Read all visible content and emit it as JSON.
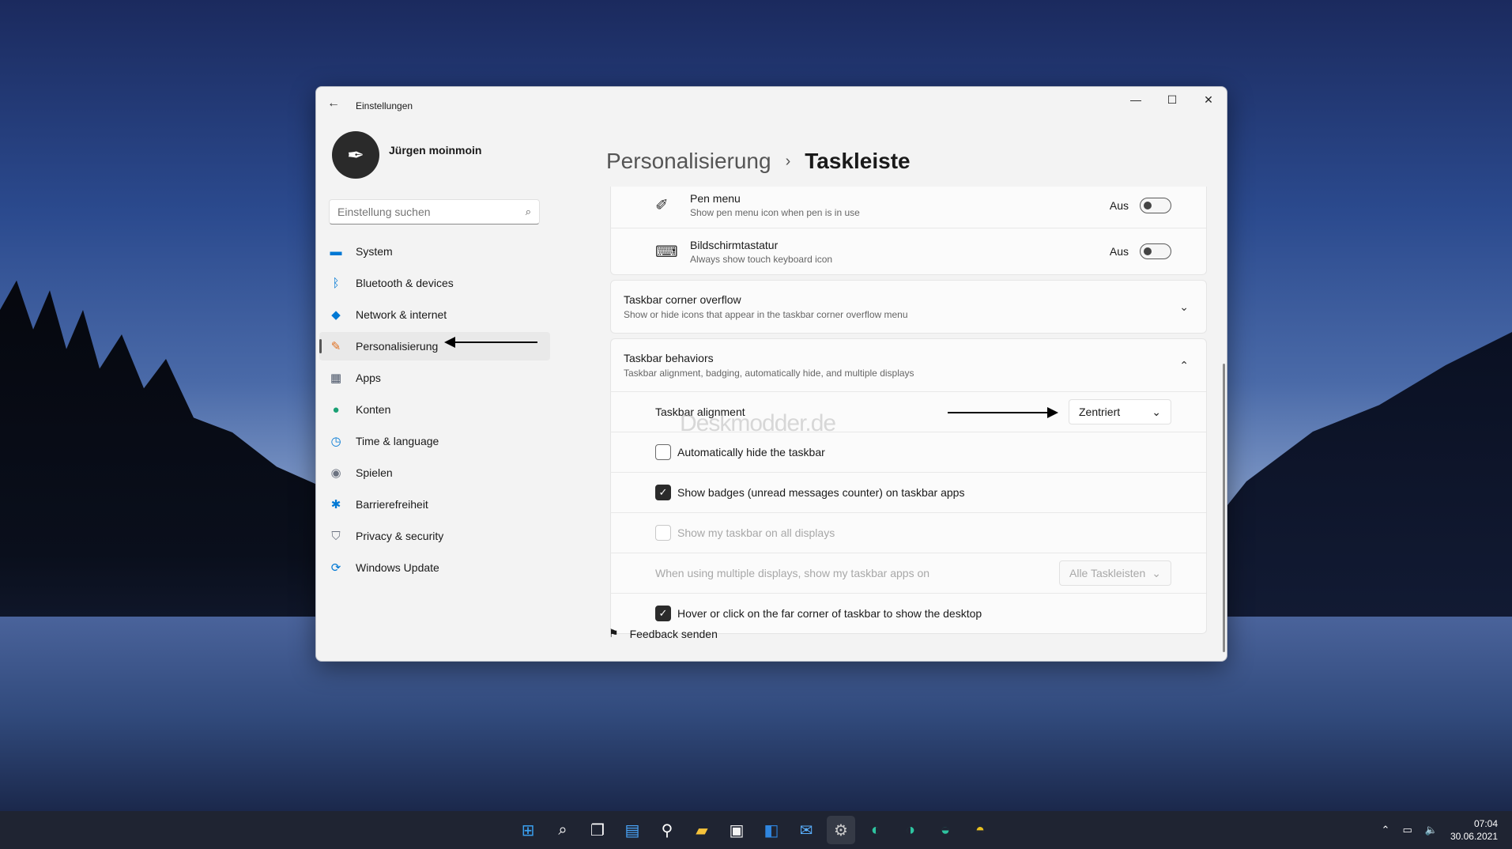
{
  "desktop": {
    "watermark": "Deskmodder.de"
  },
  "window": {
    "app_title": "Einstellungen",
    "minimize": "—",
    "maximize": "☐",
    "close": "✕"
  },
  "profile": {
    "name": "Jürgen moinmoin"
  },
  "search": {
    "placeholder": "Einstellung suchen"
  },
  "sidebar": {
    "items": [
      {
        "label": "System",
        "icon": "monitor-icon",
        "color": "#0078d4"
      },
      {
        "label": "Bluetooth & devices",
        "icon": "bluetooth-icon",
        "color": "#0078d4"
      },
      {
        "label": "Network & internet",
        "icon": "wifi-icon",
        "color": "#0078d4"
      },
      {
        "label": "Personalisierung",
        "icon": "brush-icon",
        "color": "#e07020"
      },
      {
        "label": "Apps",
        "icon": "apps-icon",
        "color": "#4a5568"
      },
      {
        "label": "Konten",
        "icon": "person-icon",
        "color": "#1aa074"
      },
      {
        "label": "Time & language",
        "icon": "globe-clock-icon",
        "color": "#0078d4"
      },
      {
        "label": "Spielen",
        "icon": "gamepad-icon",
        "color": "#6b7280"
      },
      {
        "label": "Barrierefreiheit",
        "icon": "accessibility-icon",
        "color": "#0078d4"
      },
      {
        "label": "Privacy & security",
        "icon": "shield-icon",
        "color": "#6b7280"
      },
      {
        "label": "Windows Update",
        "icon": "update-icon",
        "color": "#0078d4"
      }
    ],
    "selected": "Personalisierung"
  },
  "breadcrumb": {
    "parent": "Personalisierung",
    "separator": "›",
    "current": "Taskleiste"
  },
  "pen_menu": {
    "title": "Pen menu",
    "subtitle": "Show pen menu icon when pen is in use",
    "state": "Aus"
  },
  "touch_keyboard": {
    "title": "Bildschirmtastatur",
    "subtitle": "Always show touch keyboard icon",
    "state": "Aus"
  },
  "corner_overflow": {
    "title": "Taskbar corner overflow",
    "subtitle": "Show or hide icons that appear in the taskbar corner overflow menu"
  },
  "behaviors": {
    "title": "Taskbar behaviors",
    "subtitle": "Taskbar alignment, badging, automatically hide, and multiple displays",
    "alignment_label": "Taskbar alignment",
    "alignment_value": "Zentriert",
    "auto_hide": "Automatically hide the taskbar",
    "badges": "Show badges (unread messages counter) on taskbar apps",
    "all_displays": "Show my taskbar on all displays",
    "multi_display_label": "When using multiple displays, show my taskbar apps on",
    "multi_display_value": "Alle Taskleisten",
    "far_corner": "Hover or click on the far corner of taskbar to show the desktop"
  },
  "feedback": {
    "label": "Feedback senden"
  },
  "taskbar": {
    "time": "07:04",
    "date": "30.06.2021",
    "apps": [
      "start-icon",
      "search-icon",
      "task-view-icon",
      "widgets-icon",
      "magnifier-icon",
      "file-explorer-icon",
      "store-icon",
      "outlook-icon",
      "mail-icon",
      "settings-icon",
      "edge-icon",
      "edge-beta-icon",
      "edge-dev-icon",
      "edge-canary-icon"
    ]
  }
}
